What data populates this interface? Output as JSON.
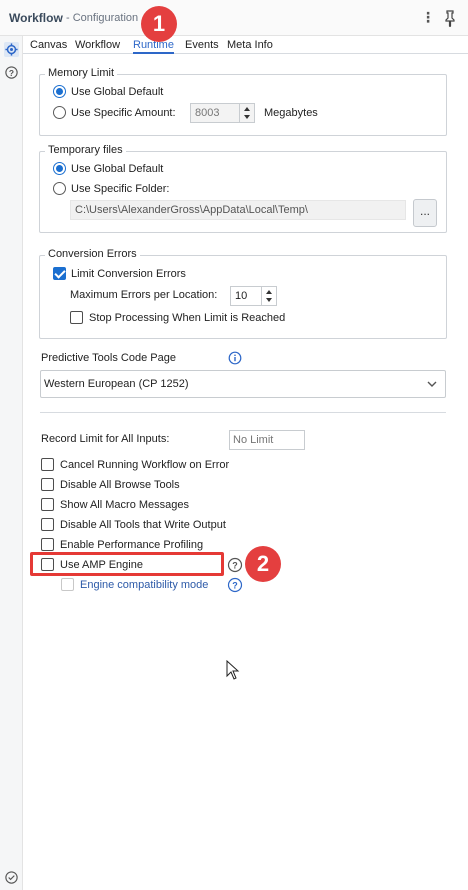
{
  "header": {
    "title": "Workflow",
    "subtitle": "- Configuration",
    "menu_icon": "kebab-menu-icon",
    "pin_icon": "pin-icon"
  },
  "leftbar": {
    "items": [
      {
        "icon": "gear-icon"
      },
      {
        "icon": "help-icon"
      },
      {
        "icon": "check-circle-icon"
      }
    ]
  },
  "tabs": [
    {
      "label": "Canvas",
      "active": false
    },
    {
      "label": "Workflow",
      "active": false
    },
    {
      "label": "Runtime",
      "active": true
    },
    {
      "label": "Events",
      "active": false
    },
    {
      "label": "Meta Info",
      "active": false
    }
  ],
  "memory_limit": {
    "title": "Memory Limit",
    "option_global": "Use Global Default",
    "option_specific": "Use Specific Amount:",
    "amount_value": "8003",
    "unit": "Megabytes",
    "selected": "global"
  },
  "temporary_files": {
    "title": "Temporary files",
    "option_global": "Use Global Default",
    "option_specific": "Use Specific Folder:",
    "folder_path": "C:\\Users\\AlexanderGross\\AppData\\Local\\Temp\\",
    "browse_label": "...",
    "selected": "global"
  },
  "conversion_errors": {
    "title": "Conversion Errors",
    "limit_label": "Limit Conversion Errors",
    "limit_checked": true,
    "max_errors_label": "Maximum Errors per Location:",
    "max_errors_value": "10",
    "stop_label": "Stop Processing When Limit is Reached",
    "stop_checked": false
  },
  "predictive": {
    "label": "Predictive Tools Code Page",
    "selected": "Western European (CP 1252)"
  },
  "record_limit": {
    "label": "Record Limit for All Inputs:",
    "placeholder": "No Limit"
  },
  "options": [
    {
      "label": "Cancel Running Workflow on Error",
      "checked": false
    },
    {
      "label": "Disable All Browse Tools",
      "checked": false
    },
    {
      "label": "Show All Macro Messages",
      "checked": false
    },
    {
      "label": "Disable All Tools that Write Output",
      "checked": false
    },
    {
      "label": "Enable Performance Profiling",
      "checked": false
    },
    {
      "label": "Use AMP Engine",
      "checked": false
    }
  ],
  "engine_compat": {
    "label": "Engine compatibility mode",
    "checked": false
  },
  "annotations": {
    "badge1": "1",
    "badge2": "2",
    "badge_color": "#e43f3f"
  },
  "colors": {
    "accent": "#1b6fd0",
    "tab_active": "#2d67c8",
    "highlight": "#e53935"
  }
}
